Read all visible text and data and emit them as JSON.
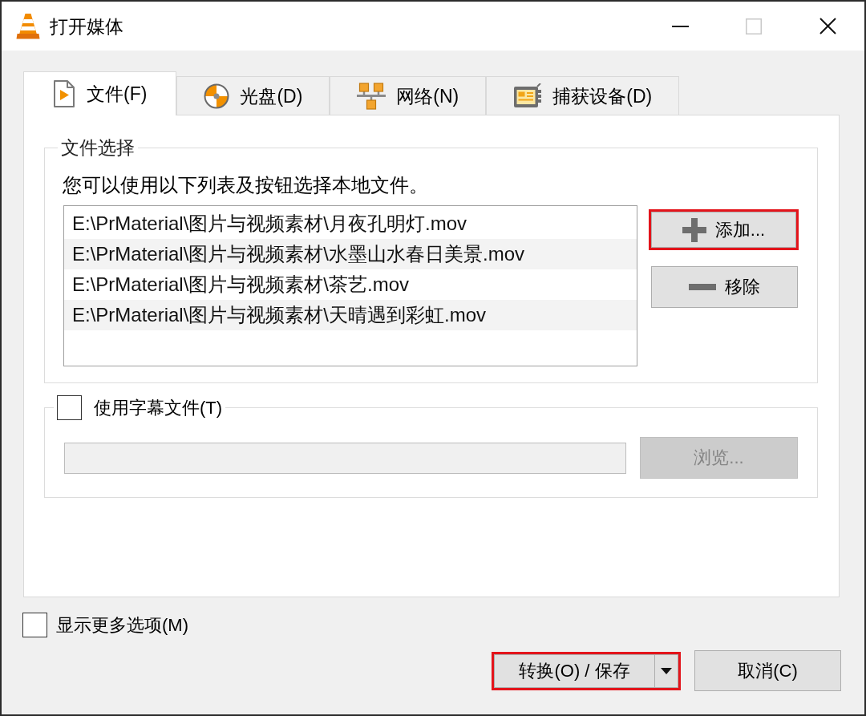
{
  "window": {
    "title": "打开媒体",
    "controls": [
      {
        "kind": "minimize",
        "disabled": false
      },
      {
        "kind": "maximize",
        "disabled": true
      },
      {
        "kind": "close",
        "disabled": false
      }
    ]
  },
  "tabs": [
    {
      "kind": "file",
      "label": "文件(F)",
      "selected": true
    },
    {
      "kind": "disc",
      "label": "光盘(D)",
      "selected": false
    },
    {
      "kind": "network",
      "label": "网络(N)",
      "selected": false
    },
    {
      "kind": "capture",
      "label": "捕获设备(D)",
      "selected": false
    }
  ],
  "file_selection": {
    "title": "文件选择",
    "description": "您可以使用以下列表及按钮选择本地文件。",
    "files": [
      "E:\\PrMaterial\\图片与视频素材\\月夜孔明灯.mov",
      "E:\\PrMaterial\\图片与视频素材\\水墨山水春日美景.mov",
      "E:\\PrMaterial\\图片与视频素材\\茶艺.mov",
      "E:\\PrMaterial\\图片与视频素材\\天晴遇到彩虹.mov"
    ],
    "buttons": [
      {
        "kind": "add",
        "label": "添加...",
        "highlighted": true
      },
      {
        "kind": "remove",
        "label": "移除",
        "highlighted": false
      }
    ]
  },
  "subtitle": {
    "label": "使用字幕文件(T)",
    "checked": false,
    "path_field": {
      "disabled": true
    },
    "browse_button": {
      "label": "浏览...",
      "disabled": true
    }
  },
  "more_options": {
    "label": "显示更多选项(M)",
    "checked": false
  },
  "footer_buttons": [
    {
      "kind": "split",
      "label": "转换(O) / 保存",
      "highlighted": true
    },
    {
      "kind": "plain",
      "label": "取消(C)",
      "highlighted": false
    }
  ]
}
